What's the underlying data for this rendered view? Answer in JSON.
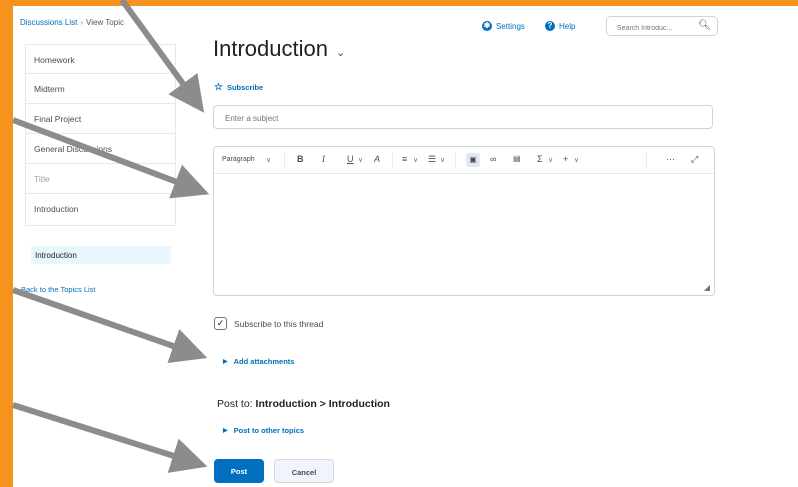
{
  "breadcrumb": {
    "parent": "Discussions List",
    "separator": "›",
    "current": "View Topic"
  },
  "topbar": {
    "settings_label": "Settings",
    "help_label": "Help",
    "search_placeholder": "Search Introduc..."
  },
  "sidebar": {
    "items": [
      {
        "label": "Homework"
      },
      {
        "label": "Midterm"
      },
      {
        "label": "Final Project"
      },
      {
        "label": "General Discussions"
      },
      {
        "label": "Title"
      },
      {
        "label": "Introduction"
      }
    ],
    "selected_topic": "Introduction",
    "back_link": "Back to the Topics List"
  },
  "main": {
    "title": "Introduction",
    "subscribe_label": "Subscribe",
    "subject_placeholder": "Enter a subject",
    "toolbar": {
      "paragraph": "Paragraph",
      "bold": "B",
      "italic": "I",
      "underline": "U",
      "format": "A",
      "sigma": "Σ",
      "plus": "+",
      "more": "···"
    },
    "subscribe_thread_label": "Subscribe to this thread",
    "add_attachments_label": "Add attachments",
    "post_to_prefix": "Post to:",
    "post_to_value": "Introduction > Introduction",
    "post_other_label": "Post to other topics",
    "post_button": "Post",
    "cancel_button": "Cancel"
  },
  "colors": {
    "accent": "#006fbf",
    "frame": "#f6921e",
    "annotation_arrow": "#8c8c8c"
  }
}
